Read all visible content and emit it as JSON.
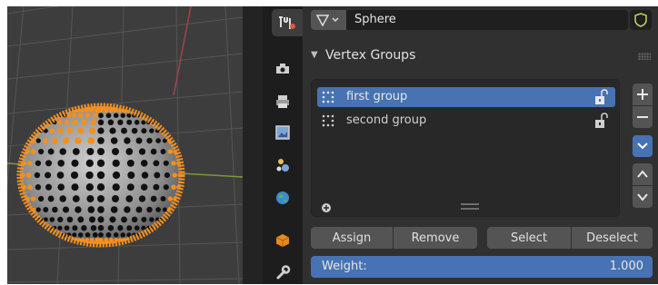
{
  "header": {
    "datablock_icon": "mesh-data-icon",
    "object_name": "Sphere",
    "fake_user_icon": "shield-icon"
  },
  "tabs": [
    {
      "name": "tool-tab",
      "icon": "tool-icon"
    },
    {
      "name": "render-tab",
      "icon": "camera-back-icon"
    },
    {
      "name": "output-tab",
      "icon": "printer-icon"
    },
    {
      "name": "view-layer-tab",
      "icon": "image-icon"
    },
    {
      "name": "scene-tab",
      "icon": "scene-icon"
    },
    {
      "name": "world-tab",
      "icon": "globe-icon"
    },
    {
      "name": "object-tab",
      "icon": "cube-icon"
    },
    {
      "name": "modifiers-tab",
      "icon": "wrench-icon"
    }
  ],
  "panel": {
    "title": "Vertex Groups",
    "groups": [
      {
        "label": "first group",
        "selected": true
      },
      {
        "label": "second group",
        "selected": false
      }
    ],
    "buttons": {
      "assign": "Assign",
      "remove": "Remove",
      "select": "Select",
      "deselect": "Deselect"
    },
    "weight": {
      "label": "Weight:",
      "value": "1.000"
    }
  },
  "colors": {
    "accent": "#4772b3",
    "selection_orange": "#f5901e",
    "panel_bg": "#303030",
    "viewport_bg": "#3d3d3d"
  }
}
